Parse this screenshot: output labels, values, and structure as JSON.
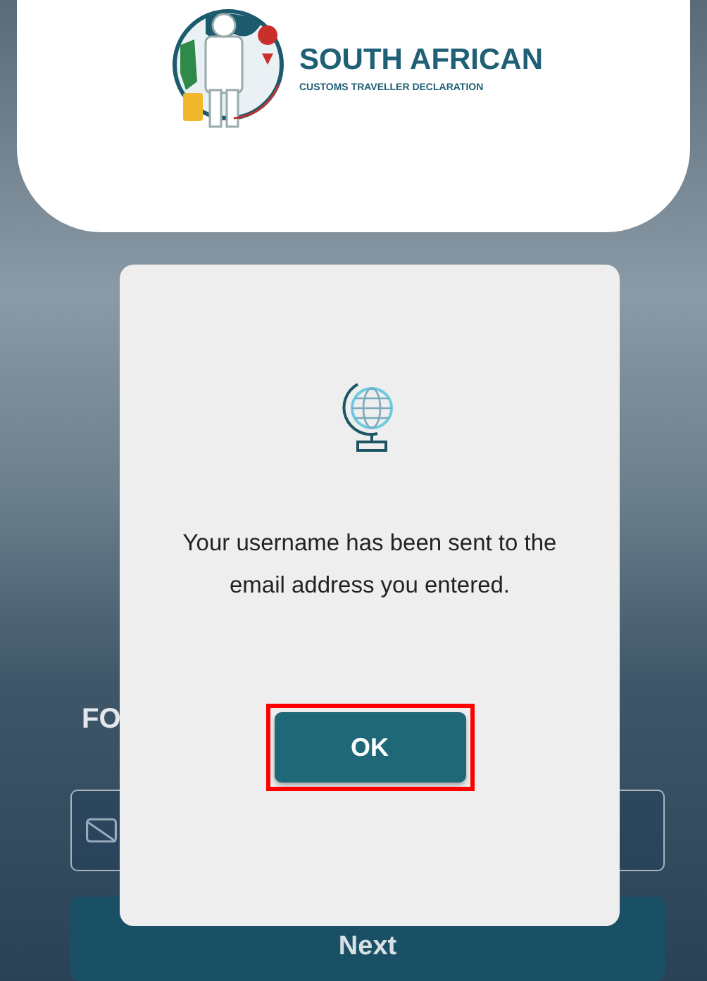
{
  "header": {
    "title": "SOUTH AFRICAN",
    "subtitle": "CUSTOMS TRAVELLER DECLARATION"
  },
  "form": {
    "title": "FO",
    "button": "Next"
  },
  "dialog": {
    "message": "Your username has been sent to the email address you entered.",
    "button": "OK",
    "button_highlighted": true
  }
}
